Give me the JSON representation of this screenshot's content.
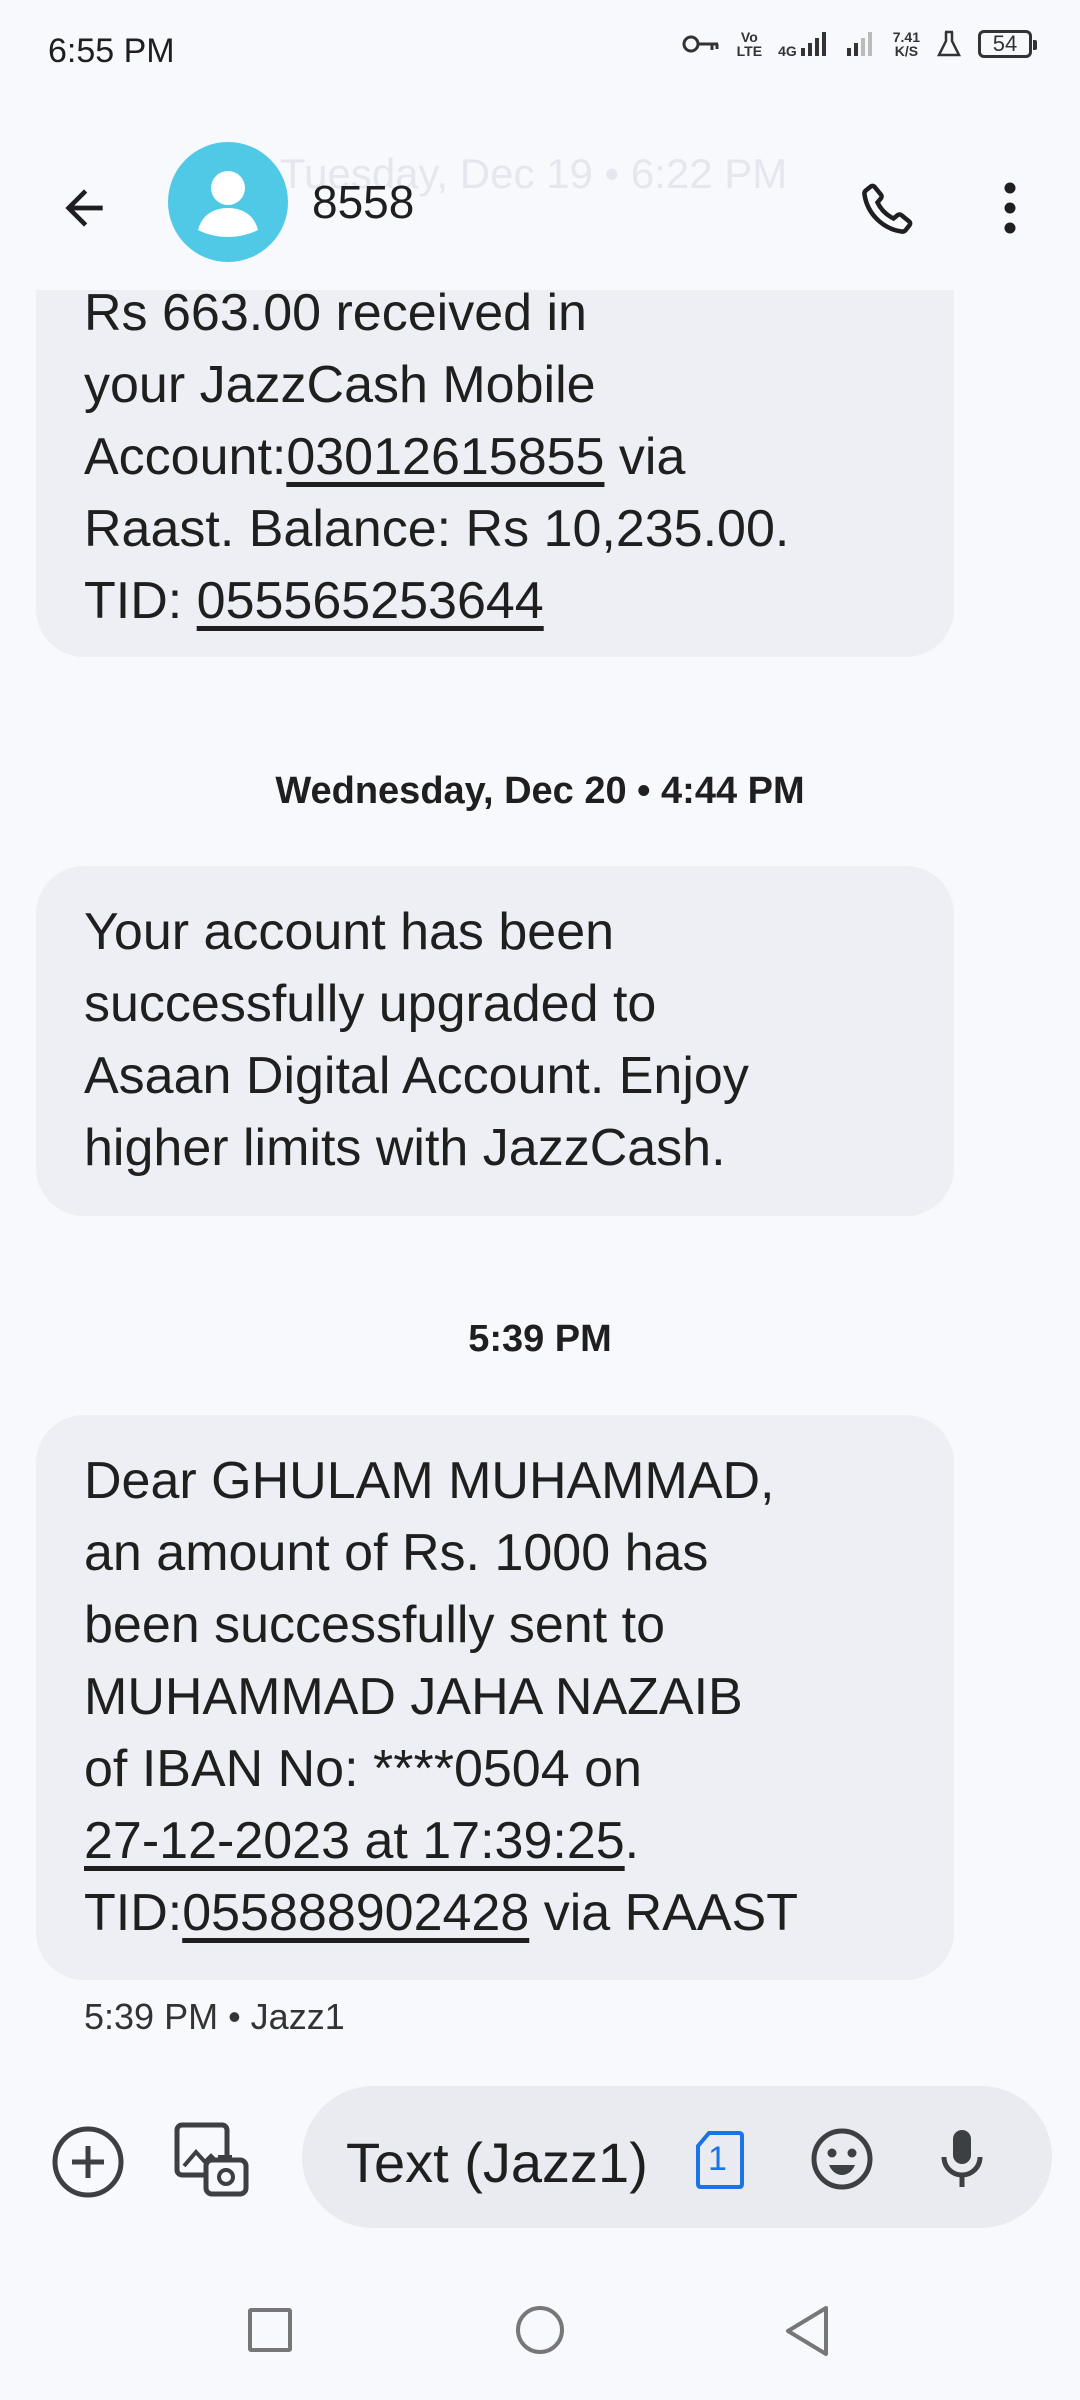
{
  "status_bar": {
    "time": "6:55 PM",
    "network_top": "Vo",
    "network_bottom": "LTE",
    "gen": "4G",
    "speed_value": "7.41",
    "speed_unit": "K/S",
    "battery": "54",
    "icons": [
      "vpn-key-icon",
      "volte-icon",
      "signal-4g-icon",
      "signal-icon",
      "speed-icon",
      "lab-icon",
      "battery-icon"
    ]
  },
  "header": {
    "ghost_date": "Tuesday, Dec 19 • 6:22 PM",
    "contact_name": "8558",
    "avatar_color": "#4fc9e6"
  },
  "messages": [
    {
      "lines": [
        [
          {
            "t": "Rs 663.00 received in",
            "u": false
          }
        ],
        [
          {
            "t": "your JazzCash Mobile",
            "u": false
          }
        ],
        [
          {
            "t": "Account:",
            "u": false
          },
          {
            "t": "03012615855",
            "u": true
          },
          {
            "t": " via",
            "u": false
          }
        ],
        [
          {
            "t": "Raast. Balance: Rs 10,235.00.",
            "u": false
          }
        ],
        [
          {
            "t": "TID: ",
            "u": false
          },
          {
            "t": "055565253644",
            "u": true
          }
        ]
      ]
    },
    {
      "date_separator": "Wednesday, Dec 20 • 4:44 PM",
      "lines": [
        [
          {
            "t": "Your account has been",
            "u": false
          }
        ],
        [
          {
            "t": "successfully upgraded to",
            "u": false
          }
        ],
        [
          {
            "t": "Asaan Digital Account. Enjoy",
            "u": false
          }
        ],
        [
          {
            "t": "higher limits with JazzCash.",
            "u": false
          }
        ]
      ]
    },
    {
      "date_separator": "5:39 PM",
      "lines": [
        [
          {
            "t": "Dear GHULAM MUHAMMAD,",
            "u": false
          }
        ],
        [
          {
            "t": "an amount of Rs. 1000 has",
            "u": false
          }
        ],
        [
          {
            "t": "been successfully sent to",
            "u": false
          }
        ],
        [
          {
            "t": "MUHAMMAD JAHA NAZAIB",
            "u": false
          }
        ],
        [
          {
            "t": "of IBAN No: ****0504 on",
            "u": false
          }
        ],
        [
          {
            "t": "27-12-2023 at 17:39:25",
            "u": true
          },
          {
            "t": ".",
            "u": false
          }
        ],
        [
          {
            "t": "TID:",
            "u": false
          },
          {
            "t": "055888902428",
            "u": true
          },
          {
            "t": " via RAAST",
            "u": false
          }
        ]
      ],
      "meta": "5:39 PM • Jazz1"
    }
  ],
  "compose": {
    "placeholder": "Text (Jazz1)",
    "sim_number": "1",
    "sim_color": "#1a73e8"
  },
  "colors": {
    "background": "#f8f9fd",
    "bubble": "#eeeff4",
    "compose_field": "#eaebf1"
  }
}
